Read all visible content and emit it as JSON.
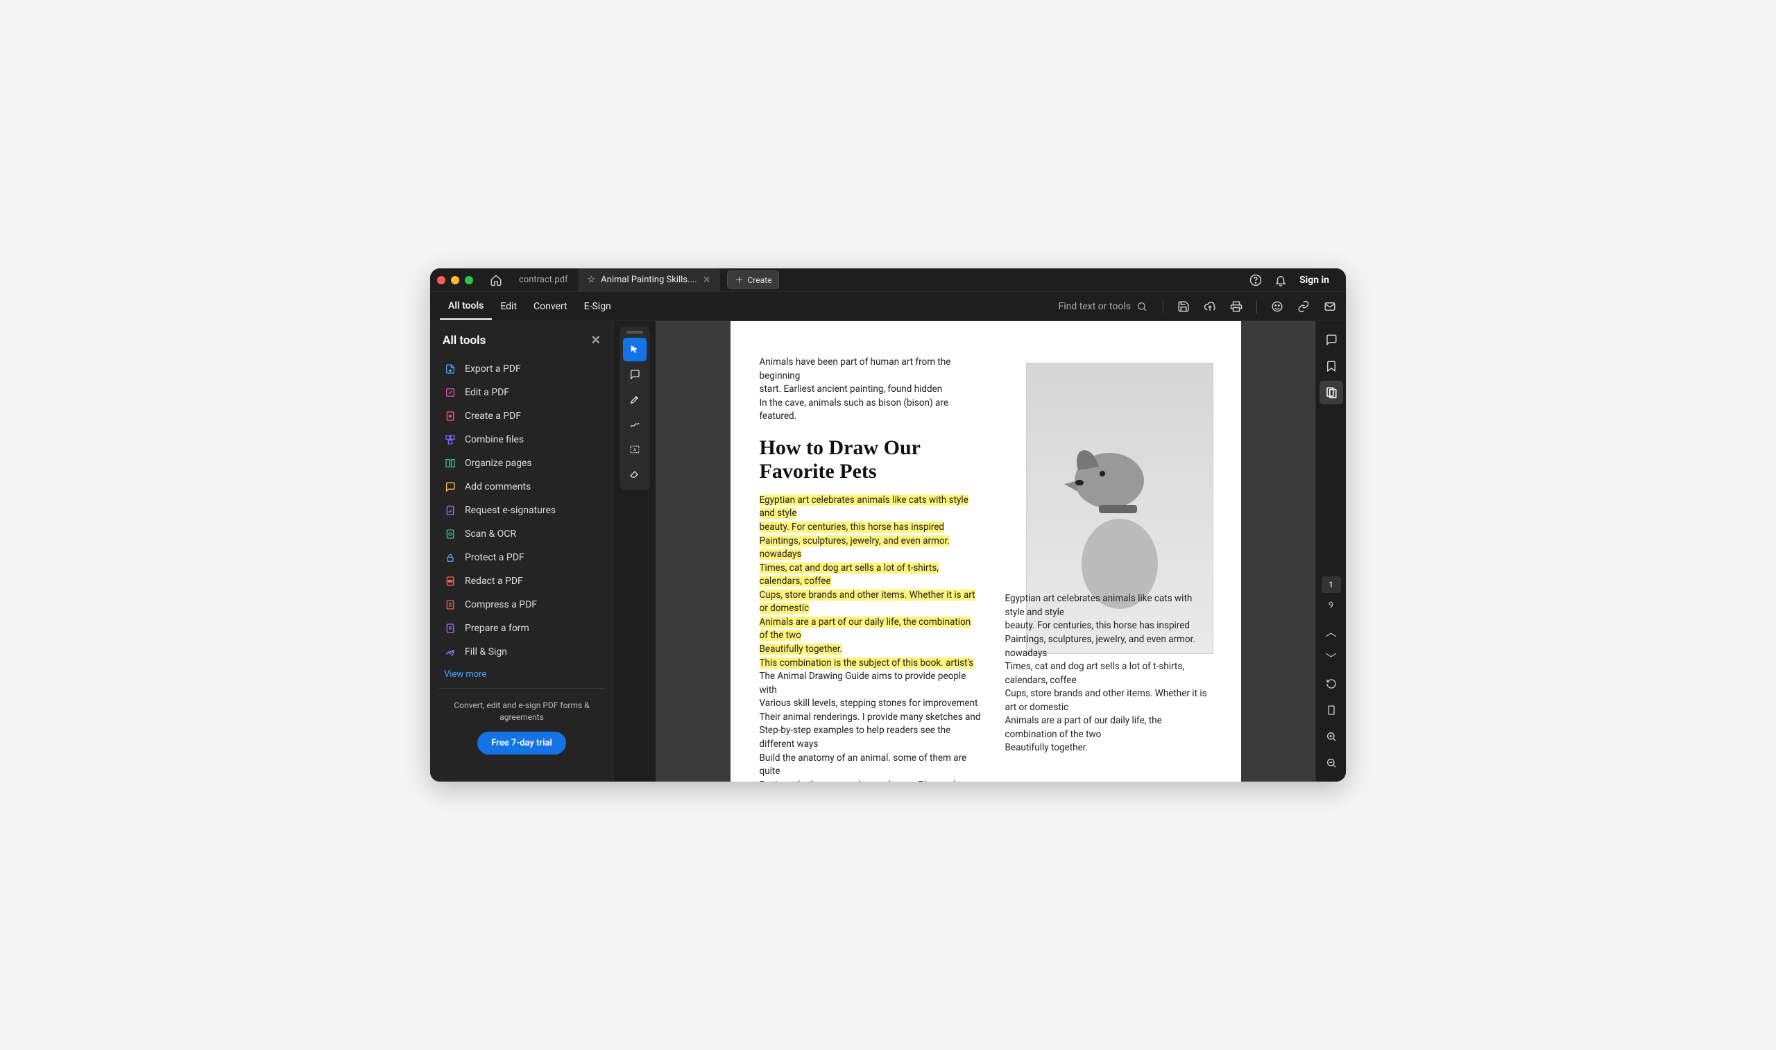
{
  "titlebar": {
    "tab1": "contract.pdf",
    "tab2": "Animal Painting Skills....",
    "create": "Create",
    "signin": "Sign in"
  },
  "menubar": {
    "all_tools": "All tools",
    "edit": "Edit",
    "convert": "Convert",
    "esign": "E-Sign",
    "search_placeholder": "Find text or tools"
  },
  "sidebar": {
    "title": "All tools",
    "items": [
      {
        "label": "Export a PDF",
        "color": "#4aa3ff"
      },
      {
        "label": "Edit a PDF",
        "color": "#e24bb5"
      },
      {
        "label": "Create a PDF",
        "color": "#ff5c5c"
      },
      {
        "label": "Combine files",
        "color": "#7b61ff"
      },
      {
        "label": "Organize pages",
        "color": "#33c481"
      },
      {
        "label": "Add comments",
        "color": "#ffb84d"
      },
      {
        "label": "Request e-signatures",
        "color": "#9b6bff"
      },
      {
        "label": "Scan & OCR",
        "color": "#33c481"
      },
      {
        "label": "Protect a PDF",
        "color": "#4aa3ff"
      },
      {
        "label": "Redact a PDF",
        "color": "#ff5c5c"
      },
      {
        "label": "Compress a PDF",
        "color": "#ff5c5c"
      },
      {
        "label": "Prepare a form",
        "color": "#9b6bff"
      },
      {
        "label": "Fill & Sign",
        "color": "#9b6bff"
      }
    ],
    "view_more": "View more",
    "promo": "Convert, edit and e-sign PDF forms & agreements",
    "trial": "Free 7-day trial"
  },
  "document": {
    "intro_lines": [
      "Animals have been part of human art from the beginning",
      "start. Earliest ancient painting, found hidden",
      "In the cave, animals such as bison (bison) are featured."
    ],
    "heading": "How to Draw Our Favorite Pets",
    "highlighted": [
      "Egyptian art celebrates animals like cats with style and style",
      "beauty. For centuries, this horse has inspired",
      "Paintings, sculptures, jewelry, and even armor. nowadays",
      "Times, cat and dog art sells a lot of t-shirts, calendars, coffee",
      "Cups, store brands and other items. Whether it is art or domestic",
      "Animals are a part of our daily life, the combination of the two",
      "Beautifully together.",
      "This combination is the subject of this book. artist's"
    ],
    "body": [
      "The Animal Drawing Guide aims to provide people with",
      "Various skill levels, stepping stones for improvement",
      "Their animal renderings. I provide many sketches and",
      "Step-by-step examples to help readers see the different ways",
      "Build the anatomy of an animal. some of them are quite",
      "Basic and other more advanced ones. Please choose"
    ],
    "col2": [
      "Egyptian art celebrates animals like cats with style and style",
      "beauty. For centuries, this horse has inspired",
      "Paintings, sculptures, jewelry, and even armor. nowadays",
      "Times, cat and dog art sells a lot of t-shirts, calendars, coffee",
      "Cups, store brands and other items. Whether it is art or domestic",
      "Animals are a part of our daily life, the combination of the two",
      "Beautifully together."
    ]
  },
  "pagenav": {
    "current": "1",
    "total": "9"
  }
}
